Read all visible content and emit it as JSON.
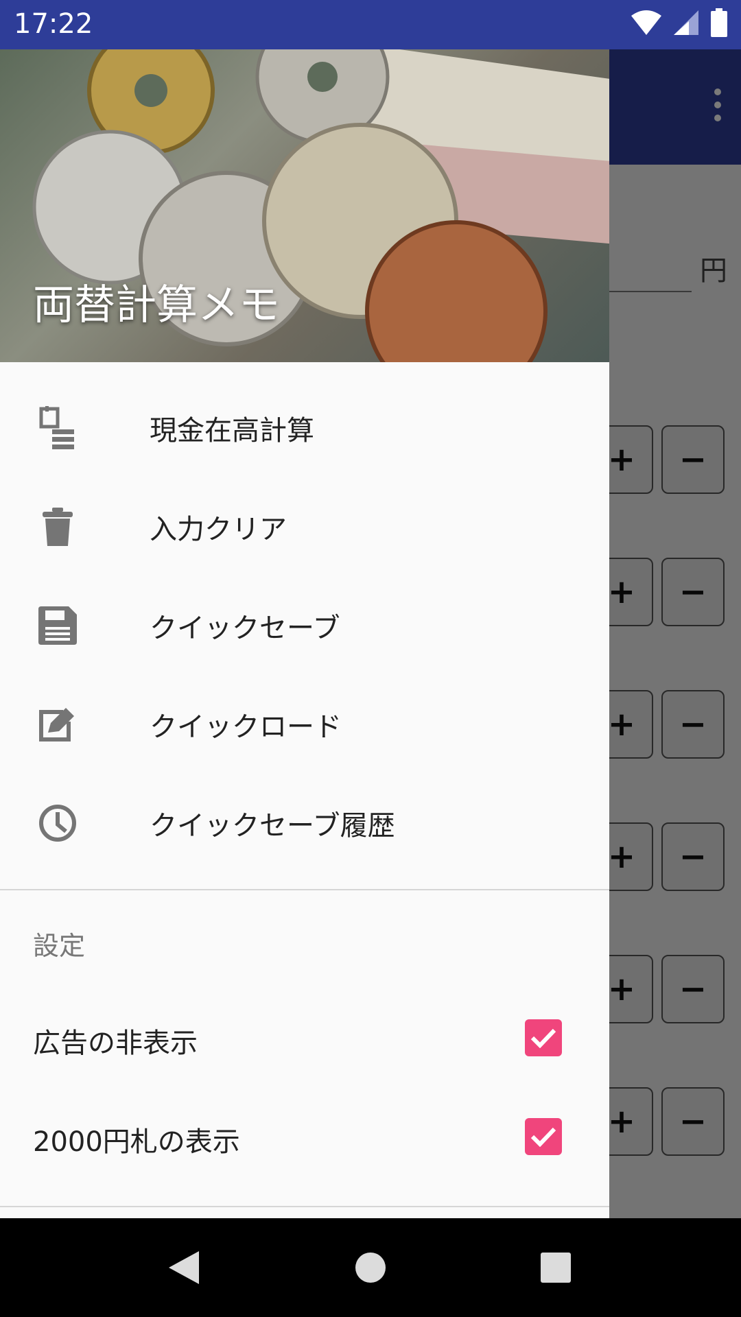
{
  "status_bar": {
    "time": "17:22"
  },
  "app": {
    "unit_label": "円",
    "plus_label": "+",
    "minus_label": "−"
  },
  "drawer": {
    "title": "両替計算メモ",
    "menu_items": [
      {
        "label": "現金在高計算",
        "icon": "cash-calculation-icon"
      },
      {
        "label": "入力クリア",
        "icon": "trash-icon"
      },
      {
        "label": "クイックセーブ",
        "icon": "save-icon"
      },
      {
        "label": "クイックロード",
        "icon": "load-icon"
      },
      {
        "label": "クイックセーブ履歴",
        "icon": "history-icon"
      }
    ],
    "settings_section": "設定",
    "settings": [
      {
        "label": "広告の非表示",
        "checked": true
      },
      {
        "label": "2000円札の表示",
        "checked": true
      }
    ]
  },
  "colors": {
    "primary": "#2e3d98",
    "accent": "#f0457c"
  }
}
